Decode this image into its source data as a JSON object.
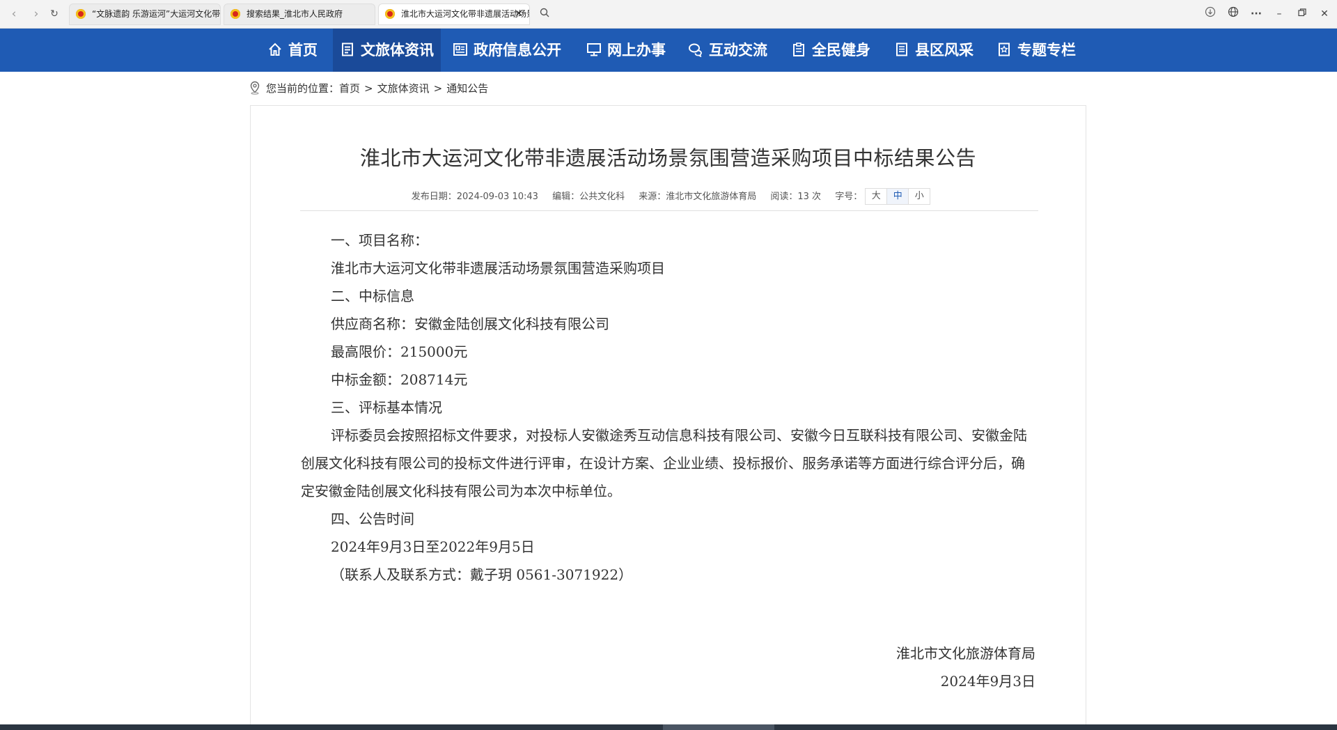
{
  "browser": {
    "tabs": [
      {
        "title": "“文脉遗韵 乐游运河”大运河文化带",
        "active": false
      },
      {
        "title": "搜索结果_淮北市人民政府",
        "active": false
      },
      {
        "title": "淮北市大运河文化带非遗展活动场景",
        "active": true
      }
    ],
    "close_glyph": "✕"
  },
  "nav": {
    "items": [
      {
        "label": "首页",
        "icon": "home-icon"
      },
      {
        "label": "文旅体资讯",
        "icon": "document-icon",
        "active": true
      },
      {
        "label": "政府信息公开",
        "icon": "newspaper-icon"
      },
      {
        "label": "网上办事",
        "icon": "monitor-icon"
      },
      {
        "label": "互动交流",
        "icon": "chat-icon"
      },
      {
        "label": "全民健身",
        "icon": "clipboard-icon"
      },
      {
        "label": "县区风采",
        "icon": "list-icon"
      },
      {
        "label": "专题专栏",
        "icon": "star-doc-icon"
      }
    ]
  },
  "breadcrumb": {
    "prefix": "您当前的位置：",
    "items": [
      "首页",
      "文旅体资讯",
      "通知公告"
    ],
    "separator": ">"
  },
  "article": {
    "title": "淮北市大运河文化带非遗展活动场景氛围营造采购项目中标结果公告",
    "meta": {
      "date": "发布日期：2024-09-03 10:43",
      "editor": "编辑：公共文化科",
      "source": "来源：淮北市文化旅游体育局",
      "reads": "阅读：13 次",
      "fontsize_label": "字号：",
      "fontsize_options": [
        "大",
        "中",
        "小"
      ]
    },
    "paragraphs": [
      "一、项目名称：",
      "淮北市大运河文化带非遗展活动场景氛围营造采购项目",
      "二、中标信息",
      "供应商名称：安徽金陆创展文化科技有限公司",
      "最高限价：215000元",
      "中标金额：208714元",
      "三、评标基本情况",
      "评标委员会按照招标文件要求，对投标人安徽途秀互动信息科技有限公司、安徽今日互联科技有限公司、安徽金陆创展文化科技有限公司的投标文件进行评审，在设计方案、企业业绩、投标报价、服务承诺等方面进行综合评分后，确定安徽金陆创展文化科技有限公司为本次中标单位。",
      "四、公告时间",
      "2024年9月3日至2022年9月5日",
      "（联系人及联系方式：戴子玥 0561-3071922）"
    ],
    "signature_org": "淮北市文化旅游体育局",
    "signature_date": "2024年9月3日"
  },
  "colors": {
    "nav_bg": "#1f5bb4",
    "nav_active": "#1a4a99"
  }
}
